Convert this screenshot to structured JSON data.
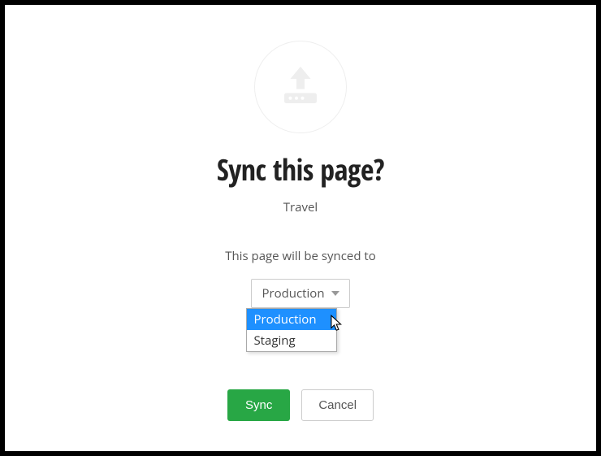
{
  "dialog": {
    "title": "Sync this page?",
    "subtitle": "Travel",
    "description": "This page will be synced to"
  },
  "dropdown": {
    "selected": "Production",
    "options": [
      {
        "label": "Production",
        "highlighted": true
      },
      {
        "label": "Staging",
        "highlighted": false
      }
    ]
  },
  "buttons": {
    "primary": "Sync",
    "secondary": "Cancel"
  },
  "colors": {
    "primary_button": "#28a745",
    "highlight": "#1e90ff"
  }
}
